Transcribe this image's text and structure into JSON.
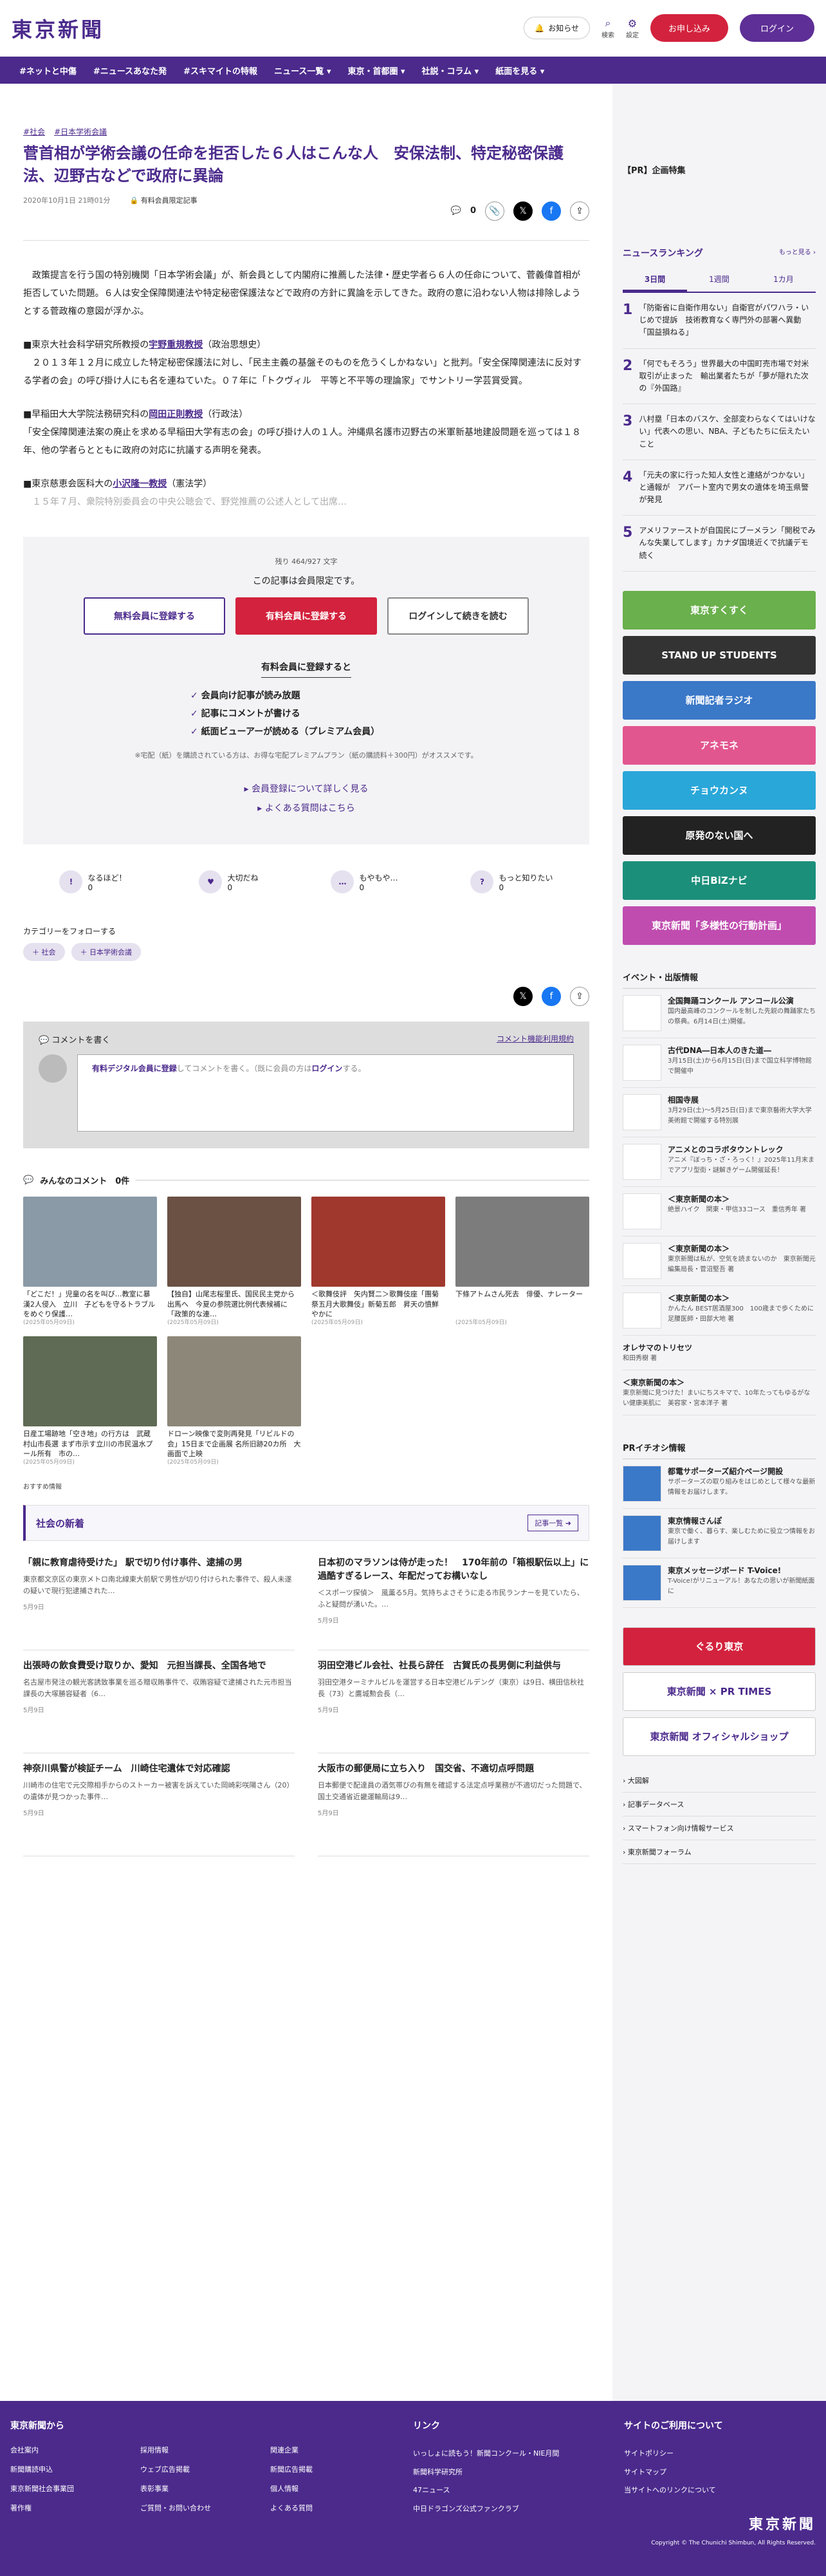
{
  "header": {
    "logo": "東京新聞",
    "notify": "お知らせ",
    "search": "検索",
    "settings": "設定",
    "apply": "お申し込み",
    "login": "ログイン"
  },
  "nav": [
    "#ネットと中傷",
    "#ニュースあなた発",
    "#スキマイトの特報",
    "ニュース一覧 ▾",
    "東京・首都圏 ▾",
    "社説・コラム ▾",
    "紙面を見る ▾"
  ],
  "article": {
    "tags": [
      "#社会",
      "#日本学術会議"
    ],
    "headline": "菅首相が学術会議の任命を拒否した６人はこんな人　安保法制、特定秘密保護法、辺野古などで政府に異論",
    "date": "2020年10月1日 21時01分",
    "members_only": "有料会員限定記事",
    "comment_count": "0",
    "paragraphs": [
      "　政策提言を行う国の特別機関「日本学術会議」が、新会員として内閣府に推薦した法律・歴史学者ら６人の任命について、菅義偉首相が拒否していた問題。６人は安全保障関連法や特定秘密保護法などで政府の方針に異論を示してきた。政府の意に沿わない人物は排除しようとする菅政権の意図が浮かぶ。",
      "　２０１３年１２月に成立した特定秘密保護法に対し、「民主主義の基盤そのものを危うくしかねない」と批判。「安全保障関連法に反対する学者の会」の呼び掛け人にも名を連ねていた。０７年に「トクヴィル　平等と不平等の理論家」でサントリー学芸賞受賞。",
      "「安全保障関連法案の廃止を求める早稲田大学有志の会」の呼び掛け人の１人。沖縄県名護市辺野古の米軍新基地建設問題を巡っては１８年、他の学者らとともに政府の対応に抗議する声明を発表。",
      "　１５年７月、衆院特別委員会の中央公聴会で、野党推薦の公述人として出席…"
    ],
    "person1_pre": "■東京大社会科学研究所教授の",
    "person1_name": "宇野重規教授",
    "person1_field": "（政治思想史）",
    "person2_pre": "■早稲田大大学院法務研究科の",
    "person2_name": "岡田正則教授",
    "person2_field": "（行政法）",
    "person3_pre": "■東京慈恵会医科大の",
    "person3_name": "小沢隆一教授",
    "person3_field": "（憲法学）"
  },
  "paywall": {
    "remaining": "残り 464/927 文字",
    "limited": "この記事は会員限定です。",
    "free_btn": "無料会員に登録する",
    "paid_btn": "有料会員に登録する",
    "login_btn": "ログインして続きを読む",
    "benefit_title": "有料会員に登録すると",
    "benefits": [
      "会員向け記事が読み放題",
      "記事にコメントが書ける",
      "紙面ビューアーが読める（プレミアム会員）"
    ],
    "note": "※宅配（紙）を購読されている方は、お得な宅配プレミアムプラン（紙の購読料＋300円）がオススメです。",
    "link1": "▸ 会員登録について詳しく見る",
    "link2": "▸ よくある質問はこちら"
  },
  "reactions": [
    {
      "icon": "!",
      "label": "なるほど！",
      "count": "0"
    },
    {
      "icon": "♥",
      "label": "大切だね",
      "count": "0"
    },
    {
      "icon": "…",
      "label": "もやもや…",
      "count": "0"
    },
    {
      "icon": "?",
      "label": "もっと知りたい",
      "count": "0"
    }
  ],
  "follow": {
    "title": "カテゴリーをフォローする",
    "tags": [
      "＋ 社会",
      "＋ 日本学術会議"
    ]
  },
  "comment_box": {
    "title": "コメントを書く",
    "rules": "コメント機能利用規約",
    "prompt_link": "有料デジタル会員に登録",
    "prompt_rest": "してコメントを書く。（既に会員の方は",
    "prompt_login": "ログイン",
    "prompt_end": "する。"
  },
  "all_comments": "みんなのコメント　0件",
  "thumbs": [
    {
      "cap": "「どこだ！」児童の名を叫び…教室に暴漢2人侵入　立川　子どもを守るトラブルをめぐり保護…",
      "date": "(2025年05月09日)",
      "color": "#8a9aa6"
    },
    {
      "cap": "【独自】山尾志桜里氏、国民民主党から出馬へ　今夏の参院選比例代表候補に「政策的な連…",
      "date": "(2025年05月09日)",
      "color": "#6b5044"
    },
    {
      "cap": "＜歌舞伎評　矢内賢二＞歌舞伎座「團菊祭五月大歌舞伎」新菊五郎　昇天の憤鮮やかに",
      "date": "(2025年05月09日)",
      "color": "#a0382e"
    },
    {
      "cap": "下條アトムさん死去　俳優、ナレーター",
      "date": "(2025年05月09日)",
      "color": "#7c7c7c"
    },
    {
      "cap": "日産工場跡地「空き地」の行方は　武蔵村山市長選 まず市示す立川の市民温水プール所有　市の…",
      "date": "(2025年05月09日)",
      "color": "#5f6b54"
    },
    {
      "cap": "ドローン映像で変則再発見「リビルドの会」15日まで企画展 名所旧跡20カ所　大画面で上映",
      "date": "(2025年05月09日)",
      "color": "#8c8778"
    }
  ],
  "rec_label": "おすすめ情報",
  "news": {
    "title": "社会の新着",
    "more": "記事一覧 ➜",
    "items": [
      {
        "h": "「親に教育虐待受けた」 駅で切り付け事件、逮捕の男",
        "p": "東京都文京区の東京メトロ南北線東大前駅で男性が切り付けられた事件で、殺人未遂の疑いで現行犯逮捕された…",
        "d": "5月9日"
      },
      {
        "h": "日本初のマラソンは侍が走った！　170年前の「箱根駅伝以上」に過酷すぎるレース、年配だってお構いなし",
        "p": "＜スポーツ探偵＞　風薫る5月。気持ちよさそうに走る市民ランナーを見ていたら、ふと疑問が湧いた。…",
        "d": "5月9日"
      },
      {
        "h": "出張時の飲食費受け取りか、愛知　元担当課長、全国各地で",
        "p": "名古屋市発注の観光客誘致事業を巡る贈収賄事件で、収賄容疑で逮捕された元市担当課長の大塚勝容疑者（6…",
        "d": "5月9日"
      },
      {
        "h": "羽田空港ビル会社、社長ら辞任　古賀氏の長男側に利益供与",
        "p": "羽田空港ターミナルビルを運営する日本空港ビルデング（東京）は9日、横田信秋社長（73）と鷹城勲会長（…",
        "d": "5月9日"
      },
      {
        "h": "神奈川県警が検証チーム　川崎住宅遺体で対応確認",
        "p": "川崎市の住宅で元交際相手からのストーカー被害を訴えていた岡崎彩咲陽さん（20）の遺体が見つかった事件…",
        "d": "5月9日"
      },
      {
        "h": "大阪市の郵便局に立ち入り　国交省、不適切点呼問題",
        "p": "日本郵便で配達員の酒気帯びの有無を確認する法定点呼業務が不適切だった問題で、国土交通省近畿運輸局は9…",
        "d": "5月9日"
      }
    ]
  },
  "sidebar": {
    "pr": "【PR】企画特集",
    "ranking_title": "ニュースランキング",
    "ranking_more": "もっと見る ›",
    "tabs": [
      "3日間",
      "1週間",
      "1カ月"
    ],
    "ranking": [
      "「防衛省に自衛作用ない」自衛官がパワハラ・いじめで提訴　技術教育なく専門外の部署へ異動「国益損ねる」",
      "「何でもそろう」世界最大の中国町売市場で対米取引が止まった　輸出業者たちが「夢が隠れた次の『外国路』",
      "八村塁「日本のバスケ、全部変わらなくてはいけない」代表への思い、NBA、子どもたちに伝えたいこと",
      "「元夫の家に行った知人女性と連絡がつかない」と通報が　アパート室内で男女の遺体を埼玉県警が発見",
      "アメリファーストが自国民にブーメラン「開税でみんな失業してします」カナダ国境近くで抗議デモ続く"
    ],
    "banners": [
      {
        "t": "東京すくすく",
        "c": "#6ab04c"
      },
      {
        "t": "STAND UP STUDENTS",
        "c": "#333333"
      },
      {
        "t": "新聞記者ラジオ",
        "c": "#3a78c8"
      },
      {
        "t": "アネモネ",
        "c": "#e2568f"
      },
      {
        "t": "チョウカンヌ",
        "c": "#2aa7d9"
      },
      {
        "t": "原発のない国へ",
        "c": "#222222"
      },
      {
        "t": "中日BiZナビ",
        "c": "#1b8f7a"
      },
      {
        "t": "東京新聞「多様性の行動計画」",
        "c": "#c04cb0"
      }
    ],
    "event_title": "イベント・出版情報",
    "events": [
      {
        "t": "全国舞踊コンクール アンコール公演",
        "s": "国内最高峰のコンクールを制した先鋭の舞踊家たちの祭典。6月14日(土)開催。"
      },
      {
        "t": "古代DNA―日本人のきた道―",
        "s": "3月15日(土)から6月15日(日)まで国立科学博物館で開催中"
      },
      {
        "t": "相国寺展",
        "s": "3月29日(土)〜5月25日(日)まで東京藝術大学大学美術館で開催する特別展"
      },
      {
        "t": "アニメとのコラボタウントレック",
        "s": "アニメ『ぼっち・ざ・ろっく！』2025年11月末までアプリ型街・謎解きゲーム開催延長！"
      },
      {
        "t": "＜東京新聞の本＞",
        "s": "絶景ハイク　関東・甲信33コース　重信秀年 著"
      },
      {
        "t": "＜東京新聞の本＞",
        "s": "東京新聞は私が、空気を読まないのか　東京新聞元編集局長・菅沼堅吾 著"
      },
      {
        "t": "＜東京新聞の本＞",
        "s": "かんたん BEST居酒屋300　100歳まで歩くために　足腰医師・田部大地 著"
      }
    ],
    "small_items": [
      {
        "t": "オレサマのトリセツ",
        "s": "和田秀樹 著"
      },
      {
        "t": "＜東京新聞の本＞",
        "s": "東京新聞に見つけた！まいにちスキマで、10年たってもゆるがない健康美肌に　美容家・宮本洋子 著"
      }
    ],
    "pr_info_title": "PRイチオシ情報",
    "pr_items": [
      {
        "t": "都電サポーターズ紹介ページ開設",
        "s": "サポーターズの取り組みをはじめとして様々な最新情報をお届けします。"
      },
      {
        "t": "東京情報さんぽ",
        "s": "東京で働く、暮らす、楽しむために役立つ情報をお届けします"
      },
      {
        "t": "東京メッセージボード T-Voice!",
        "s": "T-Voice!がリニューアル！あなたの思いが新聞紙面に"
      }
    ],
    "bottom_banners": [
      "ぐるり東京",
      "東京新聞 × PR TIMES",
      "東京新聞 オフィシャルショップ"
    ],
    "links": [
      "› 大図解",
      "› 記事データベース",
      "› スマートフォン向け情報サービス",
      "› 東京新聞フォーラム"
    ]
  },
  "footer": {
    "col1_title": "東京新聞から",
    "col1": [
      "会社案内",
      "採用情報",
      "関連企業",
      "新聞購読申込",
      "ウェブ広告掲載",
      "新聞広告掲載",
      "東京新聞社会事業団",
      "表彰事業",
      "個人情報",
      "著作権",
      "ご質問・お問い合わせ",
      "よくある質問"
    ],
    "col2_title": "リンク",
    "col2": [
      "いっしょに読もう！新聞コンクール・NIE月間",
      "新聞科学研究所",
      "47ニュース",
      "中日ドラゴンズ公式ファンクラブ"
    ],
    "col3_title": "サイトのご利用について",
    "col3": [
      "サイトポリシー",
      "サイトマップ",
      "当サイトへのリンクについて"
    ],
    "logo": "東京新聞",
    "copyright": "Copyright © The Chunichi Shimbun, All Rights Reserved."
  }
}
